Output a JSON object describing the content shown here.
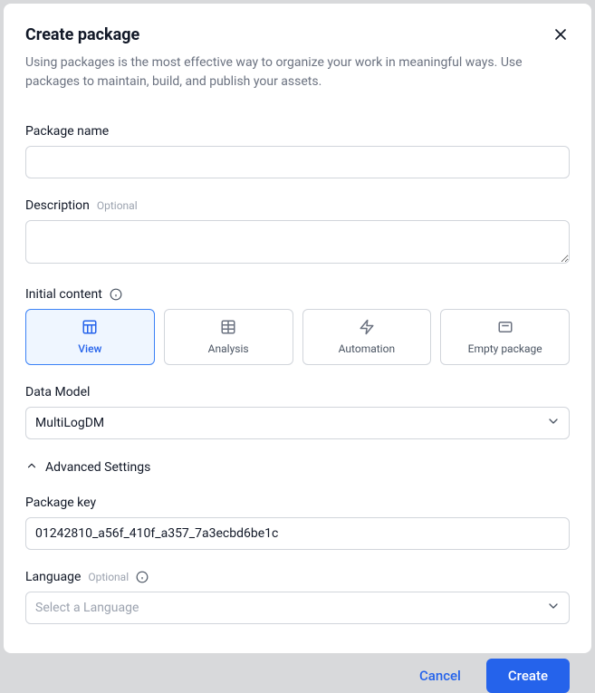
{
  "dialog": {
    "title": "Create package",
    "subtitle": "Using packages is the most effective way to organize your work in meaningful ways. Use packages to maintain, build, and publish your assets."
  },
  "form": {
    "package_name": {
      "label": "Package name",
      "value": ""
    },
    "description": {
      "label": "Description",
      "optional": "Optional",
      "value": ""
    },
    "initial_content": {
      "label": "Initial content",
      "options": {
        "view": "View",
        "analysis": "Analysis",
        "automation": "Automation",
        "empty": "Empty package"
      }
    },
    "data_model": {
      "label": "Data Model",
      "value": "MultiLogDM"
    },
    "advanced_settings": {
      "label": "Advanced Settings"
    },
    "package_key": {
      "label": "Package key",
      "value": "01242810_a56f_410f_a357_7a3ecbd6be1c"
    },
    "language": {
      "label": "Language",
      "optional": "Optional",
      "placeholder": "Select a Language"
    }
  },
  "buttons": {
    "cancel": "Cancel",
    "create": "Create"
  }
}
